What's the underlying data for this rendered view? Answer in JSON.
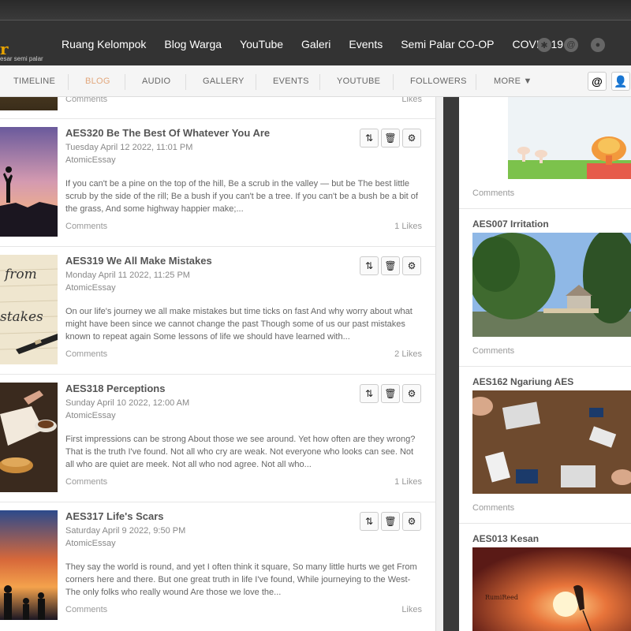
{
  "brand": {
    "logo_letter": "r",
    "tagline": "esar semi palar"
  },
  "topnav": {
    "items": [
      "Ruang Kelompok",
      "Blog Warga",
      "YouTube",
      "Galeri",
      "Events",
      "Semi Palar CO-OP",
      "COVID-19"
    ],
    "icons": [
      "paw-icon",
      "at-icon",
      "bell-icon"
    ]
  },
  "subnav": {
    "items": [
      "TIMELINE",
      "BLOG",
      "AUDIO",
      "GALLERY",
      "EVENTS",
      "YOUTUBE",
      "FOLLOWERS",
      "MORE ▼"
    ],
    "active": "BLOG"
  },
  "feed": {
    "prev_comments": "Comments",
    "prev_likes": "Likes",
    "posts": [
      {
        "title": "AES320 Be The Best Of Whatever You Are",
        "date": "Tuesday April 12 2022, 11:01 PM",
        "category": "AtomicEssay",
        "excerpt": "If you can't be a pine on the top of the hill,   Be a scrub in the valley — but be The best little scrub by the side of the rill;   Be a bush if you can't be a tree. If you can't be a bush be a bit of the grass,   And some highway happier make;...",
        "comments": "Comments",
        "likes": "1 Likes"
      },
      {
        "title": "AES319 We All Make Mistakes",
        "date": "Monday April 11 2022, 11:25 PM",
        "category": "AtomicEssay",
        "excerpt": "On our life's journey we all make mistakes but time ticks on fast And why worry about what might have been since we cannot change the past Though some of us our past mistakes known to repeat again Some lessons of life we should have learned with...",
        "comments": "Comments",
        "likes": "2 Likes"
      },
      {
        "title": "AES318 Perceptions",
        "date": "Sunday April 10 2022, 12:00 AM",
        "category": "AtomicEssay",
        "excerpt": "First impressions can be strong About those we see around. Yet how often are they wrong? That is the truth I've found. Not all who cry are weak. Not everyone who looks can see. Not all who are quiet are meek. Not all who nod agree. Not all who...",
        "comments": "Comments",
        "likes": "1 Likes"
      },
      {
        "title": "AES317 Life's Scars",
        "date": "Saturday April 9 2022, 9:50 PM",
        "category": "AtomicEssay",
        "excerpt": "They say the world is round, and yet I often think it square, So many little hurts we get From corners here and there. But one great truth in life I've found, While journeying to the West- The only folks who really wound Are those we love the...",
        "comments": "Comments",
        "likes": "Likes"
      }
    ]
  },
  "sidebar": {
    "top_comments": "Comments",
    "cards": [
      {
        "title": "AES007 Irritation",
        "comments": "Comments"
      },
      {
        "title": "AES162 Ngariung AES",
        "comments": "Comments"
      },
      {
        "title": "AES013 Kesan",
        "comments": "",
        "image_caption": "RumiReed"
      }
    ],
    "thumb_texts": [
      "from",
      "stakes"
    ]
  },
  "colors": {
    "accent": "#e2a77c",
    "brand": "#e8a300",
    "topbar": "#333333"
  }
}
